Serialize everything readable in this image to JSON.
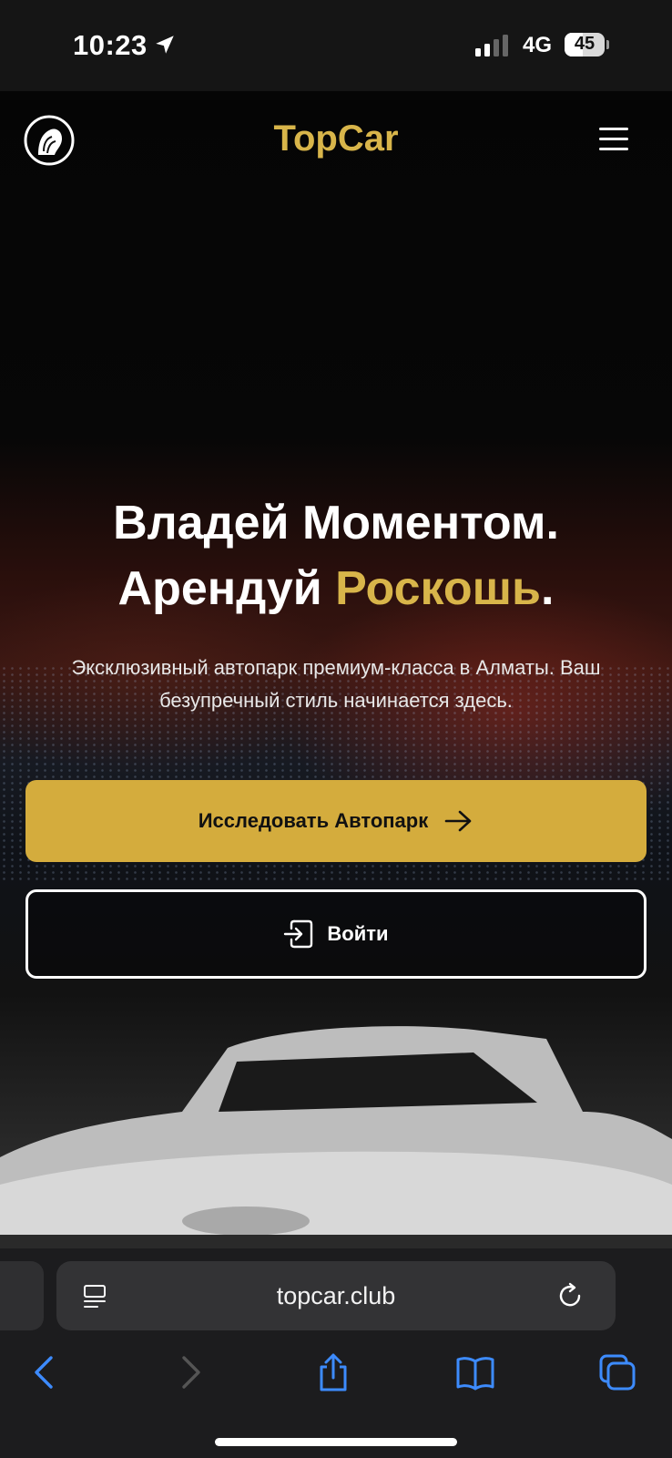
{
  "status_bar": {
    "time": "10:23",
    "network": "4G",
    "battery_level": "45",
    "battery_fraction": 0.45,
    "icons": [
      "location-arrow-icon",
      "signal-bars-icon",
      "battery-icon"
    ]
  },
  "header": {
    "brand": "TopCar",
    "logo_icon": "lion-logo-icon",
    "menu_icon": "hamburger-menu-icon"
  },
  "hero": {
    "headline_line1": "Владей Моментом.",
    "headline_line2_prefix": "Арендуй ",
    "headline_line2_highlight": "Роскошь",
    "headline_line2_suffix": ".",
    "subtitle": "Эксклюзивный автопарк премиум-класса в Алматы. Ваш безупречный стиль начинается здесь.",
    "primary_button": "Исследовать Автопарк",
    "primary_button_icon": "arrow-right-icon",
    "secondary_button": "Войти",
    "secondary_button_icon": "login-icon"
  },
  "browser": {
    "url": "topcar.club",
    "icons": [
      "reader-icon",
      "reload-icon",
      "back-icon",
      "forward-icon",
      "share-icon",
      "bookmarks-icon",
      "tabs-icon"
    ]
  },
  "colors": {
    "accent_gold": "#d8b54a",
    "button_gold": "#d4ac3d",
    "browser_bar": "#1c1c1e",
    "ios_blue": "#3d8bfd"
  }
}
